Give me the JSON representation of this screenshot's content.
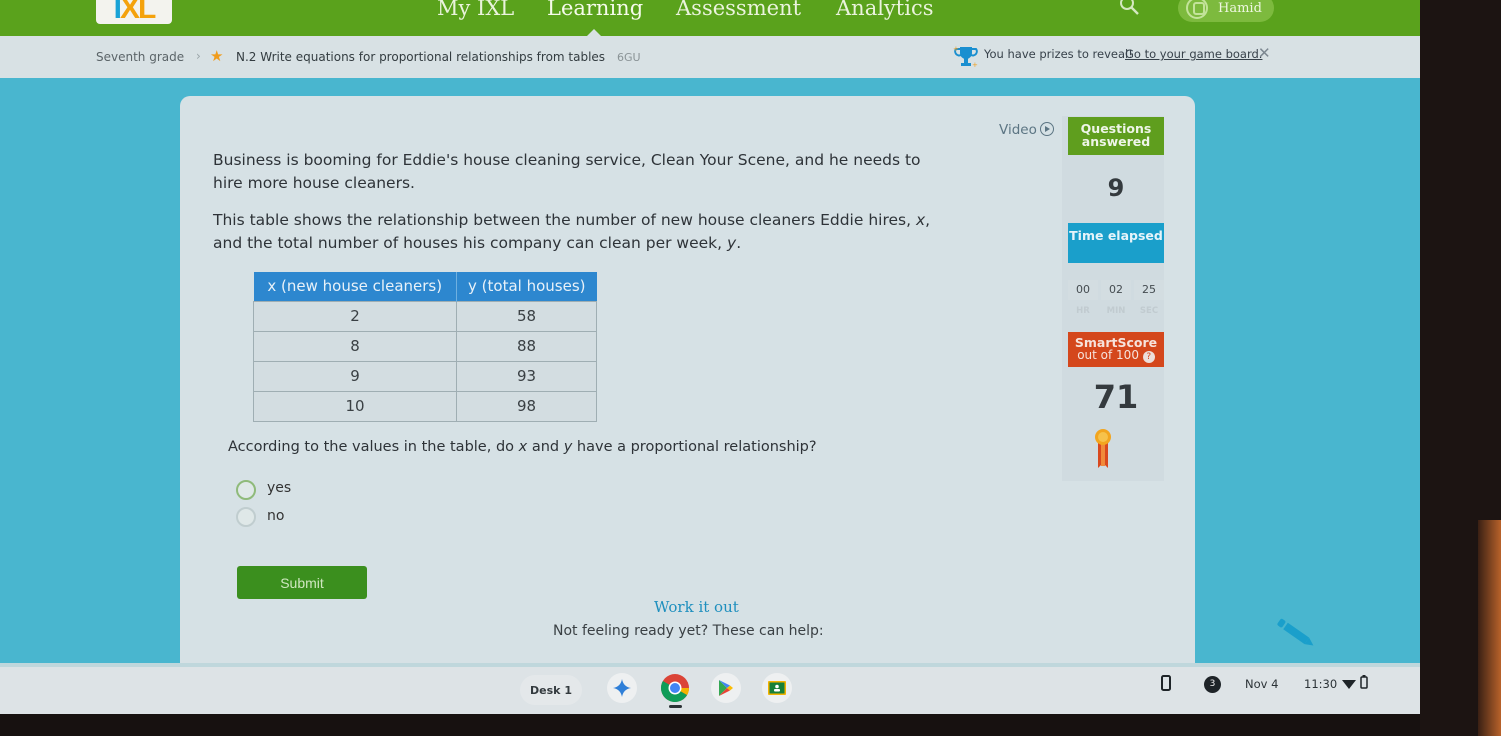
{
  "nav": {
    "logo": {
      "part1": "I",
      "part2": "XL"
    },
    "items": [
      "My IXL",
      "Learning",
      "Assessment",
      "Analytics"
    ],
    "active": "Learning",
    "user_name": "Hamid"
  },
  "breadcrumb": {
    "grade": "Seventh grade",
    "separator": "›",
    "skill": "N.2 Write equations for proportional relationships from tables",
    "skill_code": "6GU"
  },
  "prize_banner": {
    "text": "You have prizes to reveal!",
    "link": "Go to your game board.",
    "close": "✕"
  },
  "question": {
    "paragraph1_line1": "Business is booming for Eddie's house cleaning service, Clean Your Scene, and he needs to",
    "paragraph1_line2": "hire more house cleaners.",
    "paragraph2_line1": "This table shows the relationship between the number of new house cleaners Eddie hires,",
    "paragraph2_line1_var": "x",
    "paragraph2_line2": "and the total number of houses his company can clean per week,",
    "paragraph2_line2_var": "y",
    "table": {
      "headers": [
        "x (new house cleaners)",
        "y (total houses)"
      ],
      "rows": [
        [
          "2",
          "58"
        ],
        [
          "8",
          "88"
        ],
        [
          "9",
          "93"
        ],
        [
          "10",
          "98"
        ]
      ]
    },
    "prompt_part1": "According to the values in the table, do",
    "prompt_var_x": "x",
    "prompt_and": "and",
    "prompt_var_y": "y",
    "prompt_part2": "have a proportional relationship?",
    "options": [
      "yes",
      "no"
    ],
    "submit_label": "Submit"
  },
  "help": {
    "title": "Work it out",
    "subtitle": "Not feeling ready yet? These can help:"
  },
  "sidebar": {
    "video_label": "Video",
    "questions_answered_label": "Questions answered",
    "questions_answered": "9",
    "time_elapsed_label": "Time elapsed",
    "time": {
      "hr": "00",
      "min": "02",
      "sec": "25"
    },
    "time_units": {
      "hr": "HR",
      "min": "MIN",
      "sec": "SEC"
    },
    "smartscore_label": "SmartScore",
    "smartscore_sub": "out of 100",
    "smartscore": "71"
  },
  "shelf": {
    "desk_label": "Desk 1",
    "apps": [
      "gemini-icon",
      "chrome-icon",
      "play-store-icon",
      "classroom-icon"
    ],
    "notification_count": "3",
    "date": "Nov 4",
    "time": "11:30"
  },
  "colors": {
    "nav_green": "#5aa21c",
    "page_bg": "#49b6cf",
    "table_header": "#2d87cf",
    "submit_green": "#3b8f1e",
    "questions_green": "#5f9e1e",
    "time_blue": "#1a9fcb",
    "smartscore_red": "#d4471c"
  }
}
